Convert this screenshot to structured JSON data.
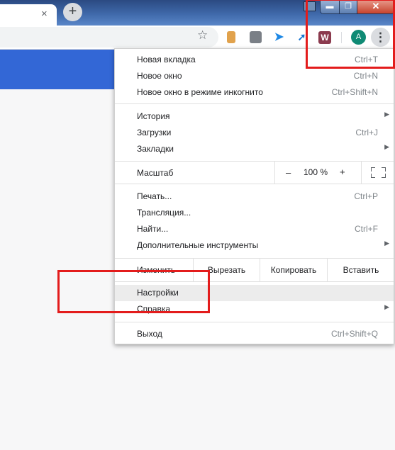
{
  "tabstrip": {
    "tab_close_icon": "×",
    "new_tab_icon": "+"
  },
  "window_controls": {
    "minimize": "▬",
    "maximize": "❐",
    "close": "✕"
  },
  "toolbar": {
    "star_icon": "☆",
    "extensions": {
      "wunderlist": "W",
      "send": "➤",
      "arrow": "➚"
    },
    "avatar_letter": "A",
    "menu_icon": "⋮"
  },
  "menu": {
    "new_tab": {
      "label": "Новая вкладка",
      "shortcut": "Ctrl+T"
    },
    "new_window": {
      "label": "Новое окно",
      "shortcut": "Ctrl+N"
    },
    "incognito": {
      "label": "Новое окно в режиме инкогнито",
      "shortcut": "Ctrl+Shift+N"
    },
    "history": {
      "label": "История"
    },
    "downloads": {
      "label": "Загрузки",
      "shortcut": "Ctrl+J"
    },
    "bookmarks": {
      "label": "Закладки"
    },
    "zoom": {
      "label": "Масштаб",
      "minus": "–",
      "value": "100 %",
      "plus": "+"
    },
    "print": {
      "label": "Печать...",
      "shortcut": "Ctrl+P"
    },
    "cast": {
      "label": "Трансляция..."
    },
    "find": {
      "label": "Найти...",
      "shortcut": "Ctrl+F"
    },
    "more_tools": {
      "label": "Дополнительные инструменты"
    },
    "edit": {
      "label": "Изменить",
      "cut": "Вырезать",
      "copy": "Копировать",
      "paste": "Вставить"
    },
    "settings": {
      "label": "Настройки"
    },
    "help": {
      "label": "Справка"
    },
    "exit": {
      "label": "Выход",
      "shortcut": "Ctrl+Shift+Q"
    },
    "submenu_arrow": "▶"
  },
  "colors": {
    "highlight": "#ececec",
    "annotation_red": "#e31c1c",
    "page_bar": "#3367d6"
  }
}
